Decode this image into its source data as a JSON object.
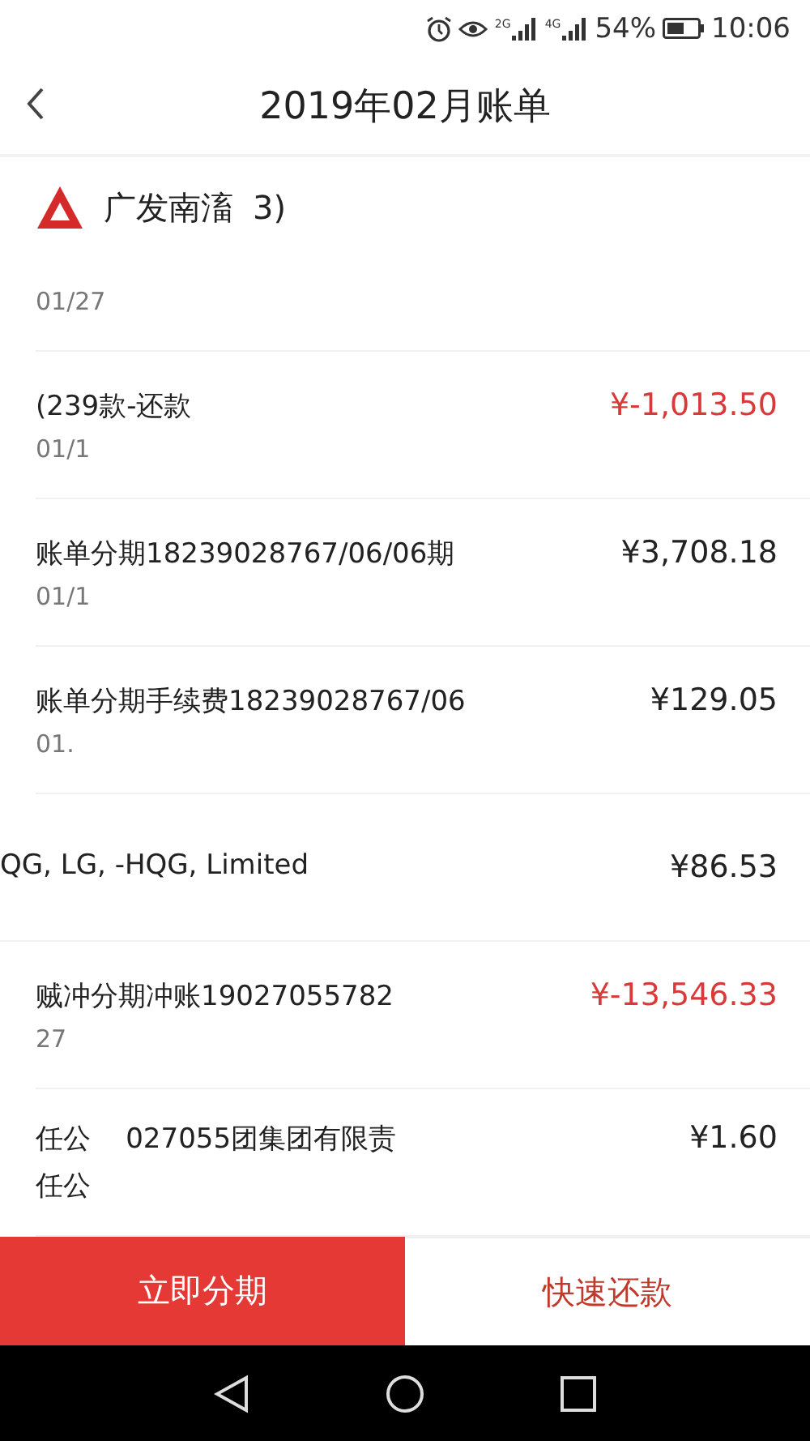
{
  "status_bar": {
    "network_1": "2G",
    "network_2": "4G",
    "battery": "54%",
    "time": "10:06"
  },
  "header": {
    "title": "2019年02月账单"
  },
  "bank": {
    "name": "广发南滀",
    "suffix": "3)"
  },
  "transactions": [
    {
      "date": "01/27"
    },
    {
      "title": "(239款-还款",
      "amount": "¥-1,013.50",
      "negative": true,
      "date": "01/1"
    },
    {
      "title": "账单分期18239028767/06/06期",
      "amount": "¥3,708.18",
      "negative": false,
      "date": "01/1"
    },
    {
      "title": "账单分期手续费18239028767/06",
      "amount": "¥129.05",
      "negative": false,
      "date": "01."
    },
    {
      "title": "QG, LG, -HQG, Limited",
      "amount": "¥86.53",
      "negative": false
    },
    {
      "title": "贼冲分期冲账19027055782",
      "amount": "¥-13,546.33",
      "negative": true,
      "date": "27"
    },
    {
      "title": "任公    027055团集团有限责",
      "title_2": "任公",
      "amount": "¥1.60",
      "negative": false
    }
  ],
  "actions": [
    {
      "label": "立即分期",
      "kind": "primary"
    },
    {
      "label": "快速还款",
      "kind": "secondary"
    }
  ]
}
